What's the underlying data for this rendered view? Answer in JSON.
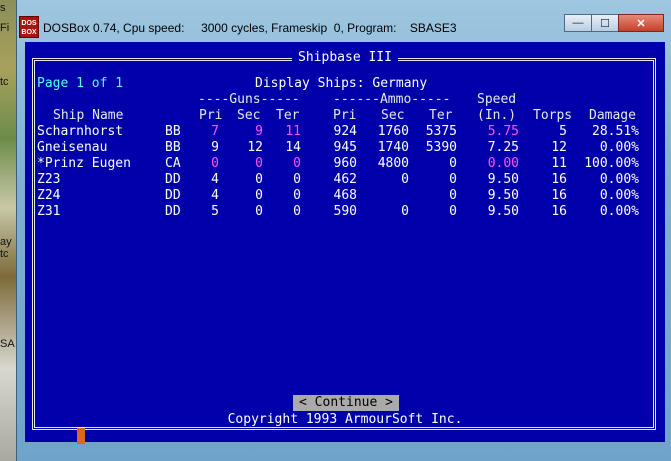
{
  "window": {
    "icon_text": "DOS\nBOX",
    "title": "DOSBox 0.74, Cpu speed:     3000 cycles, Frameskip  0, Program:    SBASE3",
    "controls": {
      "minimize": "—",
      "maximize": "☐",
      "close": "✕"
    }
  },
  "desktop": {
    "fragments": [
      "s",
      "Fi",
      "tc",
      "ay",
      "tc",
      "SA"
    ]
  },
  "app": {
    "title": "Shipbase III",
    "page_label": "Page 1 of 1",
    "subtitle": "Display Ships: Germany",
    "group_headers": {
      "guns": "----Guns-----",
      "ammo": "------Ammo-----",
      "speed": "Speed"
    },
    "columns": [
      "Ship Name",
      "Pri",
      "Sec",
      "Ter",
      "Pri",
      "Sec",
      "Ter",
      "(In.)",
      "Torps",
      "Damage"
    ],
    "rows": [
      {
        "name": "Scharnhorst",
        "type": "BB",
        "gun_pri": "7",
        "gun_sec": "9",
        "gun_ter": "11",
        "am_pri": "924",
        "am_sec": "1760",
        "am_ter": "5375",
        "speed": "5.75",
        "torps": "5",
        "damage": "28.51%",
        "highlight": true
      },
      {
        "name": "Gneisenau",
        "type": "BB",
        "gun_pri": "9",
        "gun_sec": "12",
        "gun_ter": "14",
        "am_pri": "945",
        "am_sec": "1740",
        "am_ter": "5390",
        "speed": "7.25",
        "torps": "12",
        "damage": "0.00%",
        "highlight": false
      },
      {
        "name": "*Prinz Eugen",
        "type": "CA",
        "gun_pri": "0",
        "gun_sec": "0",
        "gun_ter": "0",
        "am_pri": "960",
        "am_sec": "4800",
        "am_ter": "0",
        "speed": "0.00",
        "torps": "11",
        "damage": "100.00%",
        "highlight": true
      },
      {
        "name": "Z23",
        "type": "DD",
        "gun_pri": "4",
        "gun_sec": "0",
        "gun_ter": "0",
        "am_pri": "462",
        "am_sec": "0",
        "am_ter": "0",
        "speed": "9.50",
        "torps": "16",
        "damage": "0.00%",
        "highlight": false
      },
      {
        "name": "Z24",
        "type": "DD",
        "gun_pri": "4",
        "gun_sec": "0",
        "gun_ter": "0",
        "am_pri": "468",
        "am_sec": "",
        "am_ter": "0",
        "speed": "9.50",
        "torps": "16",
        "damage": "0.00%",
        "highlight": false
      },
      {
        "name": "Z31",
        "type": "DD",
        "gun_pri": "5",
        "gun_sec": "0",
        "gun_ter": "0",
        "am_pri": "590",
        "am_sec": "0",
        "am_ter": "0",
        "speed": "9.50",
        "torps": "16",
        "damage": "0.00%",
        "highlight": false
      }
    ],
    "continue_label": "< Continue >",
    "copyright": "Copyright 1993  ArmourSoft Inc."
  },
  "colors": {
    "screen_bg": "#0000aa",
    "page_label": "#55ffff",
    "highlight": "#ff55ff",
    "button_bg": "#aaaaaa"
  }
}
